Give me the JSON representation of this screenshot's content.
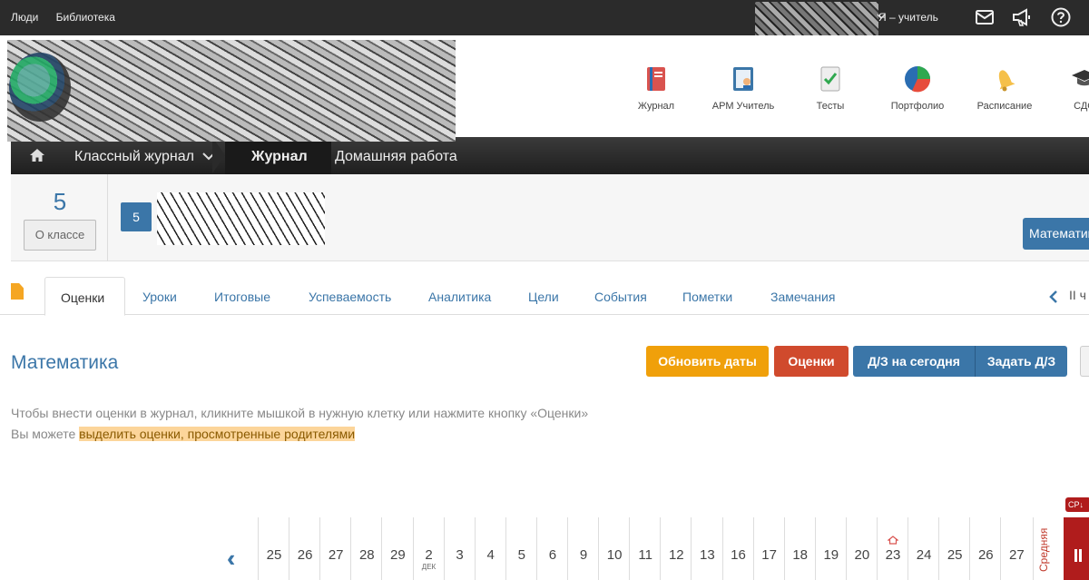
{
  "topbar": {
    "nav": [
      "Люди",
      "Библиотека"
    ],
    "user_role": "Я – учитель"
  },
  "apps": [
    {
      "label": "Журнал",
      "icon": "journal-icon"
    },
    {
      "label": "АРМ Учитель",
      "icon": "teacher-workstation-icon"
    },
    {
      "label": "Тесты",
      "icon": "tests-icon"
    },
    {
      "label": "Портфолио",
      "icon": "portfolio-pie-icon"
    },
    {
      "label": "Расписание",
      "icon": "bell-icon"
    },
    {
      "label": "СДО",
      "icon": "graduation-cap-icon"
    }
  ],
  "breadcrumb": {
    "class_journal": "Классный журнал",
    "journal": "Журнал",
    "homework": "Домашняя работа"
  },
  "classbar": {
    "class_number": "5",
    "about_class": "О классе",
    "group_badge": "5",
    "subject_button": "Математика"
  },
  "tabs": [
    "Оценки",
    "Уроки",
    "Итоговые",
    "Успеваемость",
    "Аналитика",
    "Цели",
    "События",
    "Пометки",
    "Замечания"
  ],
  "period_label": "II ч",
  "page_title": "Математика",
  "actions": {
    "update_dates": "Обновить даты",
    "grades": "Оценки",
    "hw_today": "Д/З на сегодня",
    "assign_hw": "Задать Д/З"
  },
  "hint": {
    "line1": "Чтобы внести оценки в журнал, кликните мышкой в нужную клетку или нажмите кнопку «Оценки»",
    "line2_prefix": "Вы можете ",
    "line2_link": "выделить оценки, просмотренные родителями"
  },
  "dates": [
    "25",
    "26",
    "27",
    "28",
    "29",
    "2",
    "3",
    "4",
    "5",
    "6",
    "9",
    "10",
    "11",
    "12",
    "13",
    "16",
    "17",
    "18",
    "19",
    "20",
    "23",
    "24",
    "25",
    "26",
    "27"
  ],
  "month_label": "ДЕК",
  "average_label": "Средняя",
  "sr_label": "СР↓",
  "colors": {
    "accent": "#3b76a8",
    "orange": "#f0a00a",
    "red": "#d04a2d",
    "dark_red": "#b01c1c"
  }
}
